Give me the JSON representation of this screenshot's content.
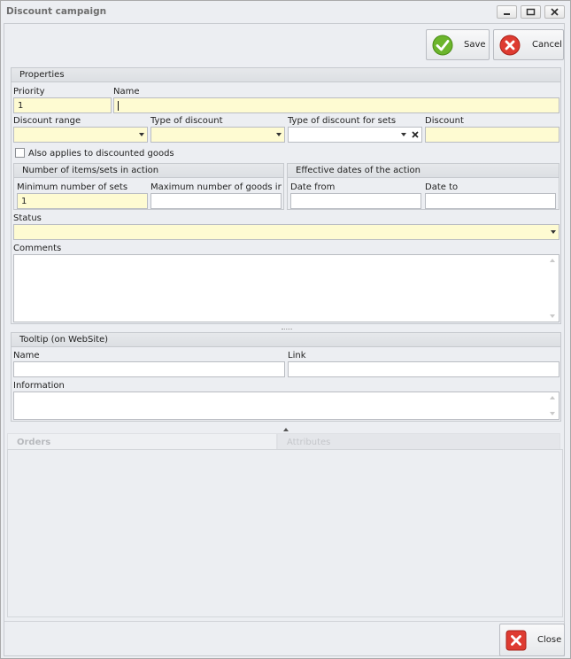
{
  "window": {
    "title": "Discount campaign"
  },
  "toolbar": {
    "save_label": "Save",
    "cancel_label": "Cancel"
  },
  "properties": {
    "header": "Properties",
    "priority_label": "Priority",
    "priority_value": "1",
    "name_label": "Name",
    "name_value": "",
    "discount_range_label": "Discount range",
    "type_of_discount_label": "Type of discount",
    "type_of_discount_sets_label": "Type of discount for sets",
    "discount_label": "Discount",
    "also_applies_label": "Also applies to discounted goods",
    "items_group": {
      "header": "Number of items/sets in action",
      "min_label": "Minimum number of sets",
      "min_value": "1",
      "max_label": "Maximum number of goods in a set"
    },
    "dates_group": {
      "header": "Effective dates of the action",
      "from_label": "Date from",
      "to_label": "Date to"
    },
    "status_label": "Status",
    "comments_label": "Comments"
  },
  "tooltip": {
    "header": "Tooltip (on WebSite)",
    "name_label": "Name",
    "link_label": "Link",
    "information_label": "Information"
  },
  "tabs": [
    {
      "label": "Orders"
    },
    {
      "label": "Attributes"
    }
  ],
  "footer": {
    "close_label": "Close"
  },
  "colors": {
    "required_field": "#fefbd2",
    "save_green": "#5aa51d",
    "cancel_red": "#d9342b"
  }
}
